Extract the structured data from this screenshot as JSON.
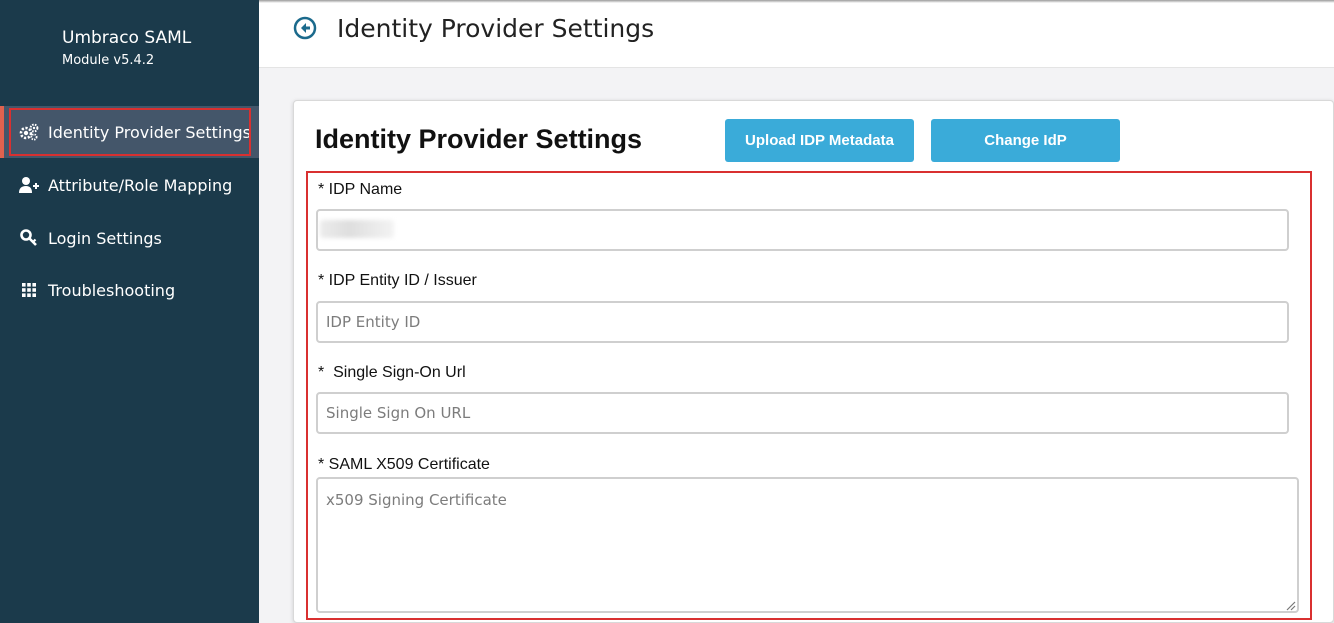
{
  "sidebar": {
    "brand_name": "Umbraco SAML",
    "brand_version": "Module v5.4.2",
    "items": [
      {
        "label": "Identity Provider Settings",
        "icon": "gears-icon",
        "active": true
      },
      {
        "label": "Attribute/Role Mapping",
        "icon": "user-plus-icon",
        "active": false
      },
      {
        "label": "Login Settings",
        "icon": "key-icon",
        "active": false
      },
      {
        "label": "Troubleshooting",
        "icon": "grid-icon",
        "active": false
      }
    ]
  },
  "header": {
    "title": "Identity Provider Settings",
    "back_icon": "back-circle-icon"
  },
  "card": {
    "title": "Identity Provider Settings",
    "upload_button": "Upload IDP Metadata",
    "change_button": "Change IdP"
  },
  "form": {
    "idp_name_label": "* IDP Name",
    "idp_name_value": "",
    "entity_id_label": "* IDP Entity ID / Issuer",
    "entity_id_placeholder": "IDP Entity ID",
    "sso_url_label": "*  Single Sign-On Url",
    "sso_url_placeholder": "Single Sign On URL",
    "cert_label": "* SAML X509 Certificate",
    "cert_placeholder": "x509 Signing Certificate"
  },
  "colors": {
    "sidebar_bg": "#1b3a4b",
    "active_item_bg": "#44566a",
    "button_bg": "#3aabd9",
    "highlight_border": "#d93030"
  }
}
